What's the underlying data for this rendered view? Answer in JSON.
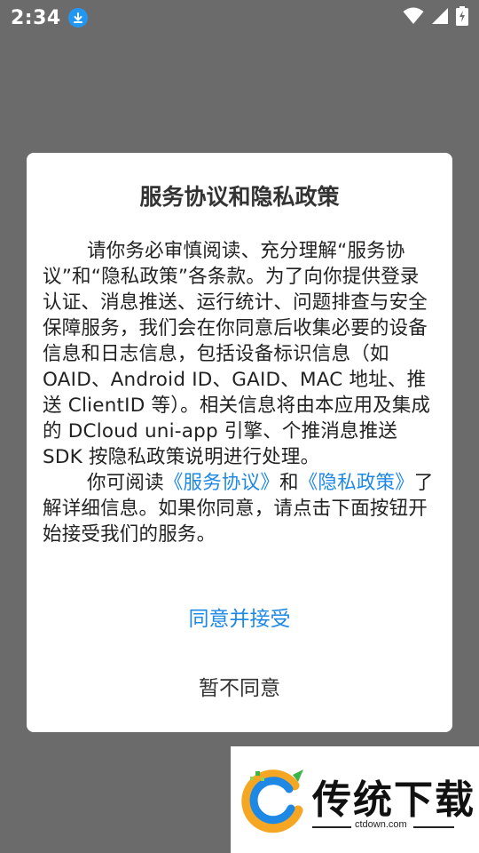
{
  "status_bar": {
    "time": "2:34",
    "icons": [
      "download-icon",
      "wifi-icon",
      "signal-icon",
      "battery-charging-icon"
    ]
  },
  "dialog": {
    "title": "服务协议和隐私政策",
    "paragraph1": "请你务必审慎阅读、充分理解“服务协议”和“隐私政策”各条款。为了向你提供登录认证、消息推送、运行统计、问题排查与安全保障服务，我们会在你同意后收集必要的设备信息和日志信息，包括设备标识信息（如 OAID、Android ID、GAID、MAC 地址、推送 ClientID 等）。相关信息将由本应用及集成的 DCloud uni-app 引擎、个推消息推送 SDK 按隐私政策说明进行处理。",
    "paragraph2_prefix": "你可阅读",
    "service_link": "《服务协议》",
    "paragraph2_and": "和",
    "privacy_link": "《隐私政策》",
    "paragraph2_suffix": "了解详细信息。如果你同意，请点击下面按钮开始接受我们的服务。",
    "agree_label": "同意并接受",
    "decline_label": "暂不同意",
    "colors": {
      "link": "#1e88e5",
      "text": "#222222"
    }
  },
  "watermark": {
    "brand": "传统下载",
    "url": "ctdown.com"
  }
}
